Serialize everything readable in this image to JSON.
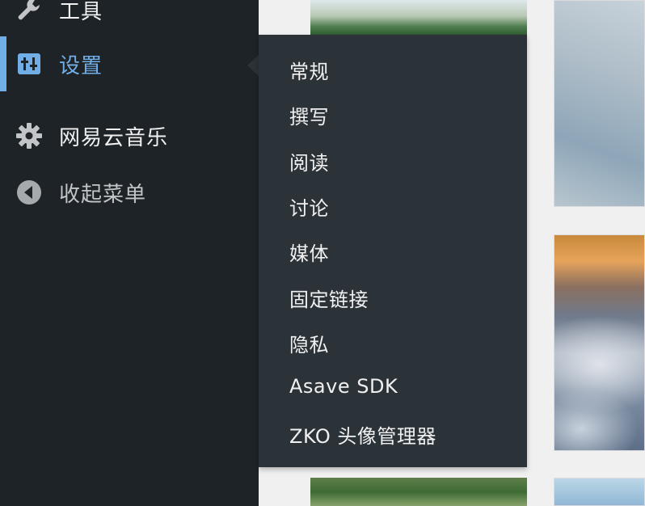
{
  "sidebar": {
    "items": [
      {
        "label": "工具",
        "icon": "wrench-icon"
      },
      {
        "label": "设置",
        "icon": "settings-sliders-icon",
        "active": true
      },
      {
        "label": "网易云音乐",
        "icon": "gear-icon"
      },
      {
        "label": "收起菜单",
        "icon": "collapse-arrow-icon"
      }
    ]
  },
  "submenu": {
    "items": [
      {
        "label": "常规"
      },
      {
        "label": "撰写"
      },
      {
        "label": "阅读"
      },
      {
        "label": "讨论"
      },
      {
        "label": "媒体"
      },
      {
        "label": "固定链接"
      },
      {
        "label": "隐私"
      },
      {
        "label": "Asave SDK"
      },
      {
        "label": "ZKO 头像管理器"
      }
    ]
  },
  "colors": {
    "sidebar_bg": "#1d2327",
    "submenu_bg": "#2c3338",
    "accent": "#72aee6",
    "text": "#f0f0f1",
    "muted_text": "#c3c4c7",
    "page_bg": "#f0f0f1"
  }
}
